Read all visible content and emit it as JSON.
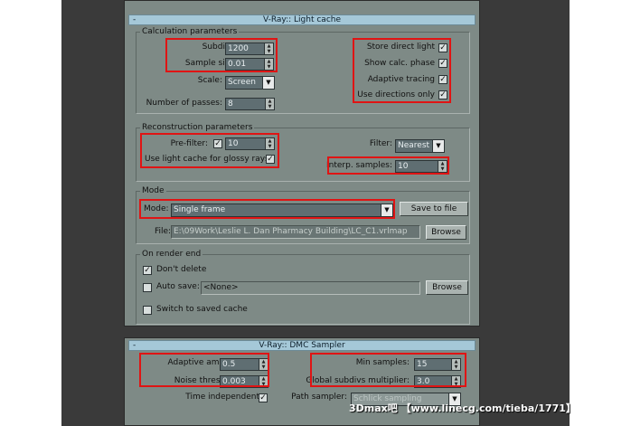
{
  "light_cache": {
    "title": "V-Ray:: Light cache",
    "collapse_icon": "-",
    "calc_params": {
      "title": "Calculation parameters",
      "subdivs_label": "Subdivs:",
      "subdivs_value": "1200",
      "sample_size_label": "Sample size:",
      "sample_size_value": "0.01",
      "scale_label": "Scale:",
      "scale_value": "Screen",
      "passes_label": "Number of passes:",
      "passes_value": "8",
      "store_direct_label": "Store direct light",
      "store_direct_checked": true,
      "show_calc_label": "Show calc. phase",
      "show_calc_checked": true,
      "adaptive_label": "Adaptive tracing",
      "adaptive_checked": true,
      "use_directions_label": "Use directions only",
      "use_directions_checked": true
    },
    "recon_params": {
      "title": "Reconstruction parameters",
      "prefilter_label": "Pre-filter:",
      "prefilter_checked": true,
      "prefilter_value": "10",
      "glossy_label": "Use light cache for glossy rays",
      "glossy_checked": true,
      "filter_label": "Filter:",
      "filter_value": "Nearest",
      "interp_label": "Interp. samples:",
      "interp_value": "10"
    },
    "mode": {
      "title": "Mode",
      "mode_label": "Mode:",
      "mode_value": "Single frame",
      "save_button": "Save to file",
      "file_label": "File:",
      "file_value": "E:\\09Work\\Leslie L. Dan Pharmacy Building\\LC_C1.vrlmap",
      "browse_button": "Browse"
    },
    "render_end": {
      "title": "On render end",
      "dont_delete_label": "Don't delete",
      "dont_delete_checked": true,
      "auto_save_label": "Auto save:",
      "auto_save_checked": false,
      "auto_save_value": "<None>",
      "browse_button": "Browse",
      "switch_label": "Switch to saved cache",
      "switch_checked": false
    }
  },
  "dmc_sampler": {
    "title": "V-Ray:: DMC Sampler",
    "collapse_icon": "-",
    "adaptive_amount_label": "Adaptive amount:",
    "adaptive_amount_value": "0.5",
    "noise_threshold_label": "Noise threshold:",
    "noise_threshold_value": "0.003",
    "time_independent_label": "Time independent",
    "time_independent_checked": true,
    "min_samples_label": "Min samples:",
    "min_samples_value": "15",
    "global_subdivs_label": "Global subdivs multiplier:",
    "global_subdivs_value": "3.0",
    "path_sampler_label": "Path sampler:",
    "path_sampler_value": "Schlick sampling"
  },
  "watermark": "3Dmax吧 【www.linecg.com/tieba/1771】",
  "colors": {
    "panel": "#7e8a86",
    "header": "#a5c8d8",
    "highlight": "#e01414",
    "field": "#5f6e72"
  }
}
